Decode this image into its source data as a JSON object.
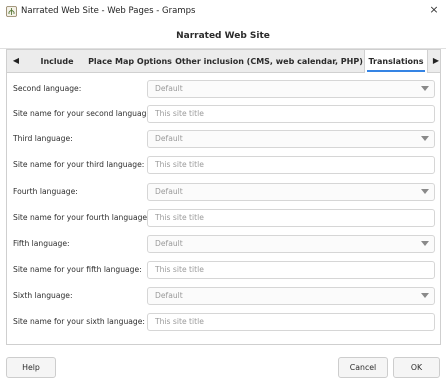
{
  "window": {
    "title": "Narrated Web Site - Web Pages - Gramps",
    "close_glyph": "×",
    "app_icon": "gramps-tree-icon"
  },
  "dialog": {
    "header": "Narrated Web Site"
  },
  "tabs": {
    "scroll_left_glyph": "◀",
    "scroll_right_glyph": "▶",
    "items": [
      {
        "label": "Include"
      },
      {
        "label": "Place Map Options"
      },
      {
        "label": "Other inclusion (CMS, web calendar, PHP)"
      },
      {
        "label": "Translations",
        "active": true
      }
    ],
    "accent_color": "#3584e4"
  },
  "translations": {
    "rows": [
      {
        "label": "Second language:",
        "type": "combo",
        "value": "Default"
      },
      {
        "label": "Site name for your second language:",
        "type": "entry",
        "placeholder": "This site title"
      },
      {
        "label": "Third language:",
        "type": "combo",
        "value": "Default"
      },
      {
        "label": "Site name for your third language:",
        "type": "entry",
        "placeholder": "This site title"
      },
      {
        "label": "Fourth language:",
        "type": "combo",
        "value": "Default"
      },
      {
        "label": "Site name for your fourth language:",
        "type": "entry",
        "placeholder": "This site title"
      },
      {
        "label": "Fifth language:",
        "type": "combo",
        "value": "Default"
      },
      {
        "label": "Site name for your fifth language:",
        "type": "entry",
        "placeholder": "This site title"
      },
      {
        "label": "Sixth language:",
        "type": "combo",
        "value": "Default"
      },
      {
        "label": "Site name for your sixth language:",
        "type": "entry",
        "placeholder": "This site title"
      }
    ]
  },
  "buttons": {
    "help": "Help",
    "cancel": "Cancel",
    "ok": "OK"
  }
}
